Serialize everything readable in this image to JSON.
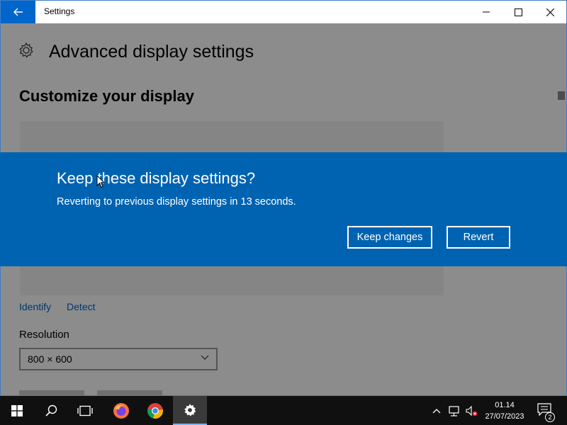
{
  "window": {
    "title": "Settings",
    "controls": [
      "minimize-icon",
      "maximize-icon",
      "close-icon"
    ]
  },
  "page": {
    "title": "Advanced display settings",
    "section_title": "Customize your display",
    "links": {
      "identify": "Identify",
      "detect": "Detect"
    },
    "resolution": {
      "label": "Resolution",
      "value": "800 × 600"
    }
  },
  "dialog": {
    "title": "Keep these display settings?",
    "message": "Reverting to previous display settings in 13 seconds.",
    "keep_label": "Keep changes",
    "revert_label": "Revert"
  },
  "taskbar": {
    "items": [
      "start-icon",
      "search-icon",
      "task-view-icon",
      "firefox-icon",
      "chrome-icon",
      "settings-icon"
    ],
    "active_item": "settings-icon",
    "tray": {
      "time": "01.14",
      "date": "27/07/2023",
      "notification_count": "2"
    }
  },
  "colors": {
    "accent": "#0063b1",
    "back_button": "#0066cc",
    "taskbar": "#101010"
  }
}
